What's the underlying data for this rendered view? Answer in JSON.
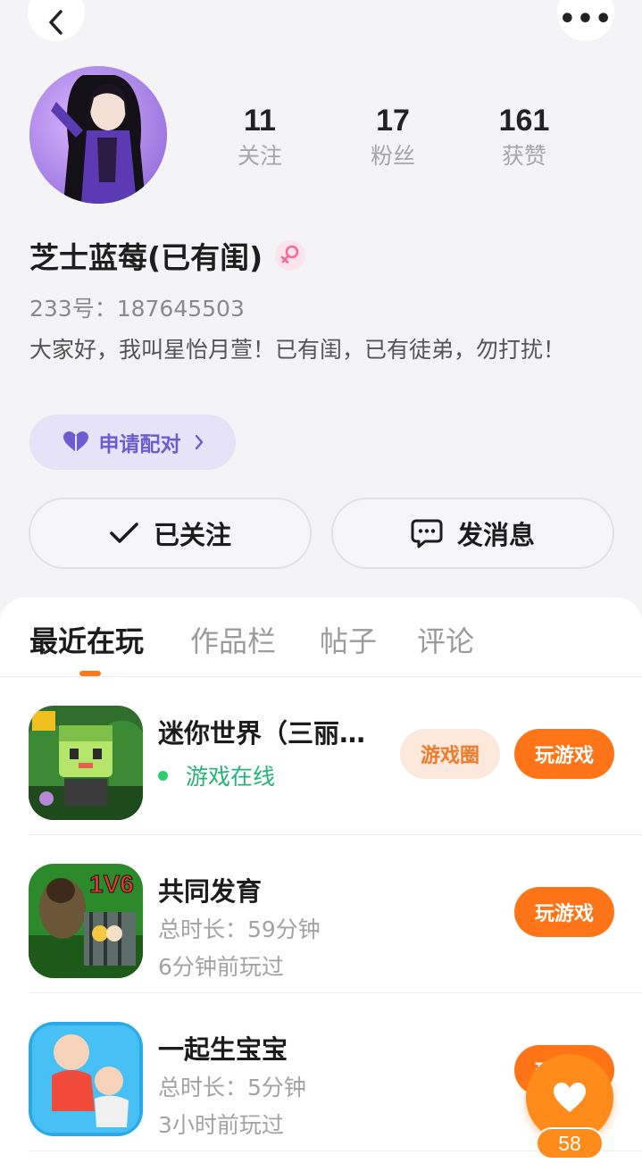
{
  "header": {
    "back_icon": "chevron-left-icon",
    "more_icon": "more-dots-icon",
    "more_glyph": "•••"
  },
  "profile": {
    "stats": [
      {
        "value": "11",
        "label": "关注"
      },
      {
        "value": "17",
        "label": "粉丝"
      },
      {
        "value": "161",
        "label": "获赞"
      }
    ],
    "username": "芝士蓝莓(已有闺)",
    "gender": "female",
    "uid": "233号：187645503",
    "bio": "大家好，我叫星怡月萱！已有闺，已有徒弟，勿打扰！",
    "pair_label": "申请配对",
    "follow_label": "已关注",
    "message_label": "发消息"
  },
  "tabs": [
    {
      "label": "最近在玩",
      "active": true
    },
    {
      "label": "作品栏",
      "active": false
    },
    {
      "label": "帖子",
      "active": false
    },
    {
      "label": "评论",
      "active": false
    }
  ],
  "games": [
    {
      "name": "迷你世界（三丽…",
      "status": "游戏在线",
      "circle_label": "游戏圈",
      "play_label": "玩游戏"
    },
    {
      "name": "共同发育",
      "duration": "总时长：59分钟",
      "last_played": "6分钟前玩过",
      "play_label": "玩游戏",
      "icon_badge": "1V6"
    },
    {
      "name": "一起生宝宝",
      "duration": "总时长：5分钟",
      "last_played": "3小时前玩过",
      "play_label": "玩游戏"
    }
  ],
  "like": {
    "count": "58"
  },
  "colors": {
    "accent": "#ff7416",
    "online": "#22b573",
    "pair": "#6b5ccf"
  }
}
